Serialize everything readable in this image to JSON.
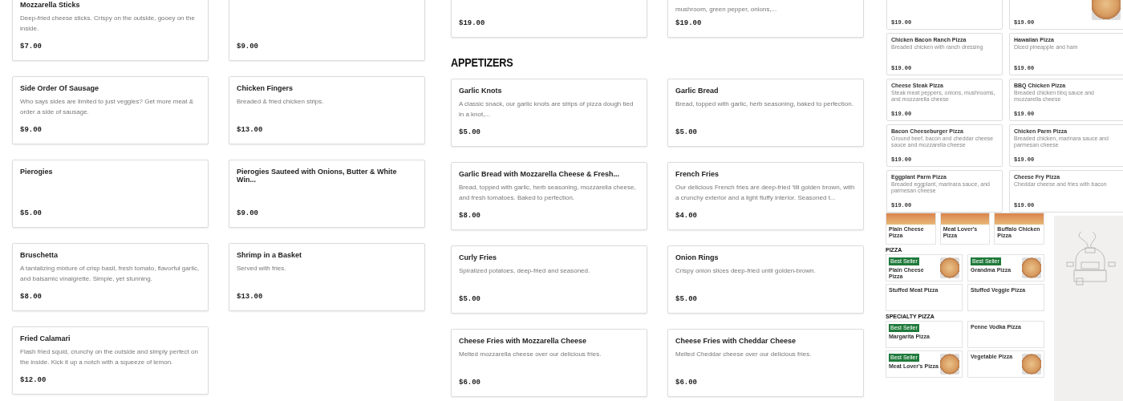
{
  "left_menu": {
    "columns": [
      [
        {
          "name": "Mozzarella Sticks",
          "description": "Deep-fried cheese sticks. Crispy on the outside, gooey on the inside.",
          "price": "$7.00"
        },
        {
          "name": "Side Order Of Sausage",
          "description": "Who says sides are limited to just veggies? Get more meat & order a side of sausage.",
          "price": "$9.00"
        },
        {
          "name": "Pierogies",
          "price": "$5.00"
        },
        {
          "name": "Bruschetta",
          "description": "A tantalizing mixture of crisp basil, fresh tomato, flavorful garlic, and balsamic vinaigrette. Simple, yet stunning.",
          "price": "$8.00"
        },
        {
          "name": "Fried Calamari",
          "description": "Flash fried squid, crunchy on the outside and simply perfect on the inside. Kick it up a notch with a squeeze of lemon.",
          "price": "$12.00"
        }
      ],
      [
        {
          "price": "$9.00"
        },
        {
          "name": "Chicken Fingers",
          "description": "Breaded & fried chicken strips.",
          "price": "$13.00"
        },
        {
          "name": "Pierogies Sauteed with Onions, Butter & White Win...",
          "price": "$9.00"
        },
        {
          "name": "Shrimp in a Basket",
          "description": "Served with fries.",
          "price": "$13.00"
        }
      ]
    ]
  },
  "middle_menu": {
    "top_row": [
      {
        "price": "$19.00"
      },
      {
        "description": "mushroom, green pepper, onions,...",
        "price": "$19.00"
      }
    ],
    "section": {
      "heading": "APPETIZERS",
      "items": [
        {
          "name": "Garlic Knots",
          "description": "A classic snack, our garlic knots are strips of pizza dough tied in a knot,...",
          "price": "$5.00"
        },
        {
          "name": "Garlic Bread",
          "description": "Bread, topped with garlic, herb seasoning, baked to perfection.",
          "price": "$5.00"
        },
        {
          "name": "Garlic Bread with Mozzarella Cheese & Fresh...",
          "description": "Bread, topped with garlic, herb seasoning, mozzarella cheese, and fresh tomatoes. Baked to perfection.",
          "price": "$8.00"
        },
        {
          "name": "French Fries",
          "description": "Our delicious French fries are deep-fried 'till golden brown, with a crunchy exterior and a light fluffy interior. Seasoned t...",
          "price": "$4.00"
        },
        {
          "name": "Curly Fries",
          "description": "Spiralized potatoes, deep-fried and seasoned.",
          "price": "$5.00"
        },
        {
          "name": "Onion Rings",
          "description": "Crispy onion slices deep-fried until golden-brown.",
          "price": "$5.00"
        },
        {
          "name": "Cheese Fries with Mozzarella Cheese",
          "description": "Melted mozzarella cheese over our delicious fries.",
          "price": "$6.00"
        },
        {
          "name": "Cheese Fries with Cheddar Cheese",
          "description": "Melted Cheddar cheese over our delicious fries.",
          "price": "$6.00"
        }
      ]
    }
  },
  "preview_top": {
    "cards": [
      {
        "price": "$19.00",
        "photo": false
      },
      {
        "price": "$19.00",
        "photo": true
      },
      {
        "name": "Chicken Bacon Ranch Pizza",
        "description": "Breaded chicken with ranch dressing",
        "price": "$19.00",
        "photo": false
      },
      {
        "name": "Hawaiian Pizza",
        "description": "Diced pineapple and ham",
        "price": "$19.00",
        "photo": false
      },
      {
        "name": "Cheese Steak Pizza",
        "description": "Steak meat peppers, onions, mushrooms, and mozzarella cheese",
        "price": "$19.00",
        "photo": false
      },
      {
        "name": "BBQ Chicken Pizza",
        "description": "Breaded chicken bbq sauce and mozzarella cheese",
        "price": "$19.00",
        "photo": false
      },
      {
        "name": "Bacon Cheeseburger Pizza",
        "description": "Ground beef, bacon and cheddar cheese sauce and mozzarella cheese",
        "price": "$19.00",
        "photo": false
      },
      {
        "name": "Chicken Parm Pizza",
        "description": "Breaded chicken, marinara sauce and parmesan cheese",
        "price": "$19.00",
        "photo": false
      },
      {
        "name": "Eggplant Parm Pizza",
        "description": "Breaded eggplant, marinara sauce, and parmesan cheese",
        "price": "$19.00",
        "photo": false
      },
      {
        "name": "Cheese Fry Pizza",
        "description": "Cheddar cheese and fries with bacon",
        "price": "$19.00",
        "photo": false
      }
    ]
  },
  "preview_bottom": {
    "top_cards": [
      {
        "name": "Plain Cheese Pizza"
      },
      {
        "name": "Meat Lover's Pizza"
      },
      {
        "name": "Buffalo Chicken Pizza"
      }
    ],
    "sections": [
      {
        "heading": "PIZZA",
        "cards": [
          {
            "badge": "Best Seller",
            "name": "Plain Cheese Pizza",
            "photo": true
          },
          {
            "badge": "Best Seller",
            "name": "Grandma Pizza",
            "photo": true
          },
          {
            "name": "Stuffed Meat Pizza",
            "photo": false
          },
          {
            "name": "Stuffed Veggie Pizza",
            "photo": false
          }
        ]
      },
      {
        "heading": "SPECIALTY PIZZA",
        "cards": [
          {
            "badge": "Best Seller",
            "name": "Margarita Pizza",
            "photo": false
          },
          {
            "name": "Penne Vodka Pizza",
            "photo": false
          },
          {
            "badge": "Best Seller",
            "name": "Meat Lover's Pizza",
            "photo": true
          },
          {
            "name": "Vegetable Pizza",
            "photo": true
          }
        ]
      }
    ]
  }
}
